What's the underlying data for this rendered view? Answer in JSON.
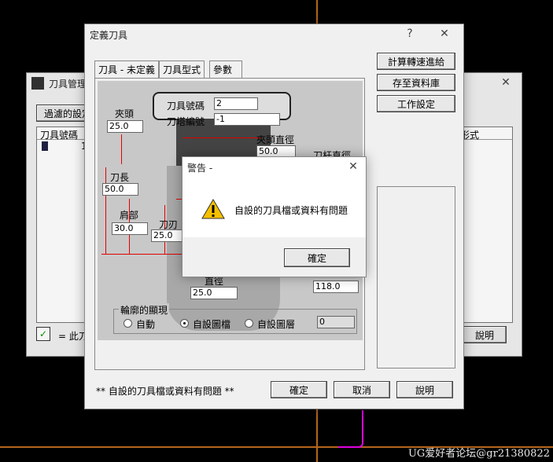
{
  "background": {
    "watermark": "UG爱好者论坛@gr21380822",
    "colors": {
      "cad_line": "#b5651d",
      "path": "#e000e0"
    }
  },
  "back_window": {
    "title": "刀具管理",
    "filter_button": "過濾的設定",
    "column_1": "刀具號碼",
    "column_1_value": "1",
    "column_right": "形式",
    "legend_text": "= 此刀",
    "help_button": "說明"
  },
  "main_window": {
    "title": "定義刀具",
    "help_icon": "?",
    "close_icon": "✕",
    "tabs": [
      {
        "label": "刀具 - 未定義"
      },
      {
        "label": "刀具型式"
      },
      {
        "label": "參數"
      }
    ],
    "side_buttons": {
      "calc": "計算轉速進給",
      "save_db": "存至資料庫",
      "work_settings": "工作設定"
    },
    "fields": {
      "tool_number_label": "刀具號碼",
      "tool_number_value": "2",
      "holder_number_label": "刀塔編號",
      "holder_number_value": "-1",
      "collet_label": "夾頭",
      "collet_value": "25.0",
      "collet_dia_label": "夾頭直徑",
      "collet_dia_value": "50.0",
      "length_label": "刀長",
      "length_value": "50.0",
      "shoulder_label": "肩部",
      "shoulder_value": "30.0",
      "flute_label": "刀刃",
      "flute_value": "25.0",
      "diameter_label": "直徑",
      "diameter_value": "25.0",
      "right_value": "118.0",
      "partial_label": "刀杆直徑"
    },
    "profile_group": {
      "title": "輪廓的顯現",
      "options": [
        "自動",
        "自設圖檔",
        "自設圖層"
      ],
      "selected": "自設圖檔",
      "layer_value": "0"
    },
    "status_text": "** 自設的刀具檔或資料有問題 **",
    "ok": "確定",
    "cancel": "取消",
    "help": "說明"
  },
  "alert": {
    "title": "警告 -",
    "message": "自設的刀具檔或資料有問題",
    "ok": "確定",
    "close_icon": "✕"
  }
}
